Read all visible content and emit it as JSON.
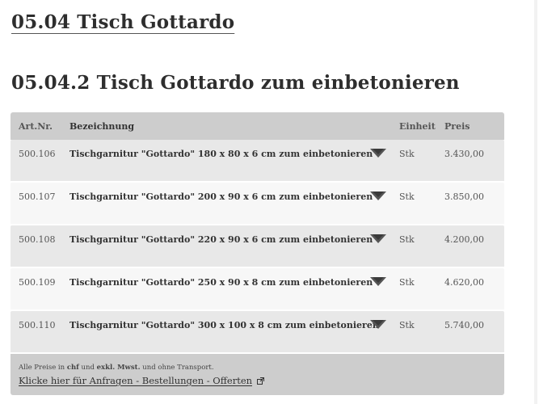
{
  "heading_main": "05.04 Tisch Gottardo",
  "heading_sub": "05.04.2 Tisch Gottardo zum einbetonieren",
  "table": {
    "columns": {
      "artnr": "Art.Nr.",
      "bezeichnung": "Bezeichnung",
      "einheit": "Einheit",
      "preis": "Preis"
    },
    "rows": [
      {
        "artnr": "500.106",
        "bezeichnung": "Tischgarnitur \"Gottardo\" 180 x 80 x 6 cm zum einbetonieren",
        "einheit": "Stk",
        "preis": "3.430,00"
      },
      {
        "artnr": "500.107",
        "bezeichnung": "Tischgarnitur \"Gottardo\" 200 x 90 x 6 cm zum einbetonieren",
        "einheit": "Stk",
        "preis": "3.850,00"
      },
      {
        "artnr": "500.108",
        "bezeichnung": "Tischgarnitur \"Gottardo\" 220 x 90 x 6 cm zum einbetonieren",
        "einheit": "Stk",
        "preis": "4.200,00"
      },
      {
        "artnr": "500.109",
        "bezeichnung": "Tischgarnitur \"Gottardo\" 250 x 90 x 8 cm zum einbetonieren",
        "einheit": "Stk",
        "preis": "4.620,00"
      },
      {
        "artnr": "500.110",
        "bezeichnung": "Tischgarnitur \"Gottardo\" 300 x 100 x 8 cm zum einbetonieren",
        "einheit": "Stk",
        "preis": "5.740,00"
      }
    ]
  },
  "footer": {
    "note_prefix": "Alle Preise in ",
    "note_currency": "chf",
    "note_middle": " und ",
    "note_tax": "exkl. Mwst.",
    "note_suffix": " und ohne Transport.",
    "link_text": "Klicke hier für Anfragen - Bestellungen - Offerten"
  },
  "icons": {
    "row_toggle": "chevron-down-icon",
    "link_icon": "external-link-icon"
  }
}
